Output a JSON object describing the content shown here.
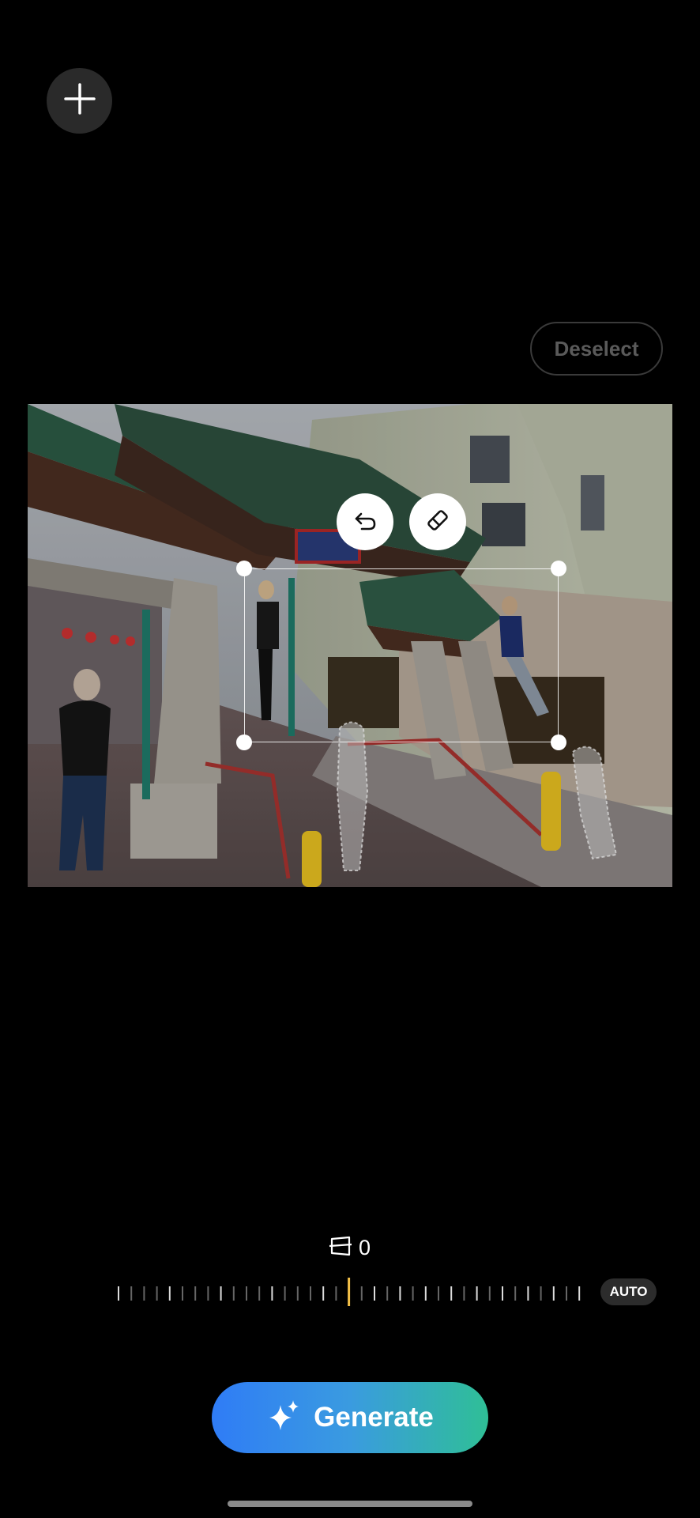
{
  "toolbar": {
    "add_icon": "plus-icon",
    "deselect_label": "Deselect"
  },
  "editor": {
    "undo_icon": "undo-icon",
    "erase_icon": "eraser-icon"
  },
  "adjust": {
    "tilt_icon": "perspective-tilt-icon",
    "tilt_value": "0",
    "auto_label": "AUTO"
  },
  "actions": {
    "generate_label": "Generate",
    "generate_icon": "sparkle-icon"
  },
  "colors": {
    "background": "#000000",
    "accent_start": "#2f7cf6",
    "accent_end": "#2fbf96",
    "slider_marker": "#f3c048"
  }
}
